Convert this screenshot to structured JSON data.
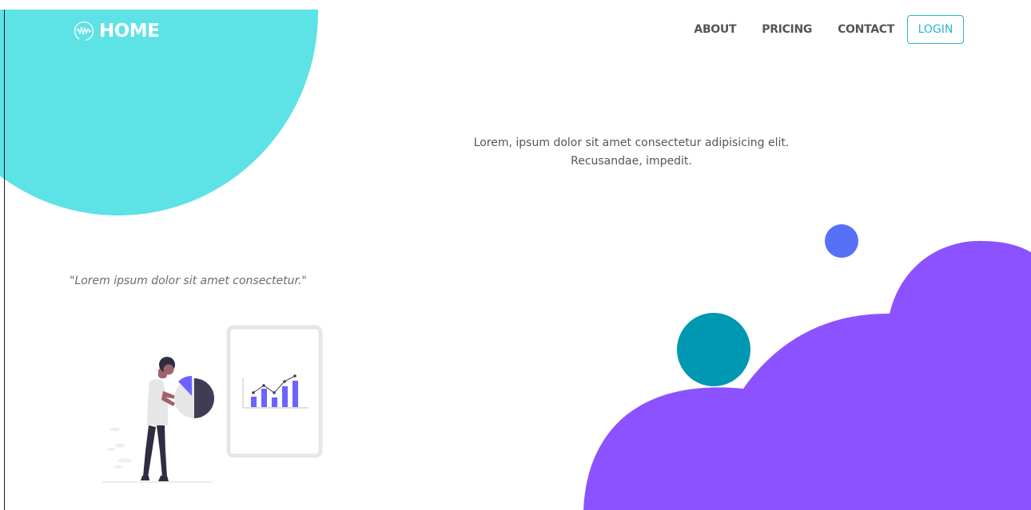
{
  "brand": {
    "logo_icon": "wave-pulse-icon",
    "name": "HOME"
  },
  "nav": {
    "links": [
      "ABOUT",
      "PRICING",
      "CONTACT"
    ],
    "login_label": "LOGIN"
  },
  "hero": {
    "line1": "Lorem, ipsum dolor sit amet consectetur adipisicing elit.",
    "line2": "Recusandae, impedit."
  },
  "quote": "\"Lorem ipsum dolor sit amet consectetur.\"",
  "colors": {
    "cyan_blob": "#5de2e6",
    "purple_cloud": "#8c52ff",
    "teal_dot": "#0097b2",
    "blue_dot": "#5670f8",
    "accent": "#29b6cf",
    "nav_text": "#555555"
  },
  "illustration": {
    "name": "person-presenting-charts-illustration"
  }
}
